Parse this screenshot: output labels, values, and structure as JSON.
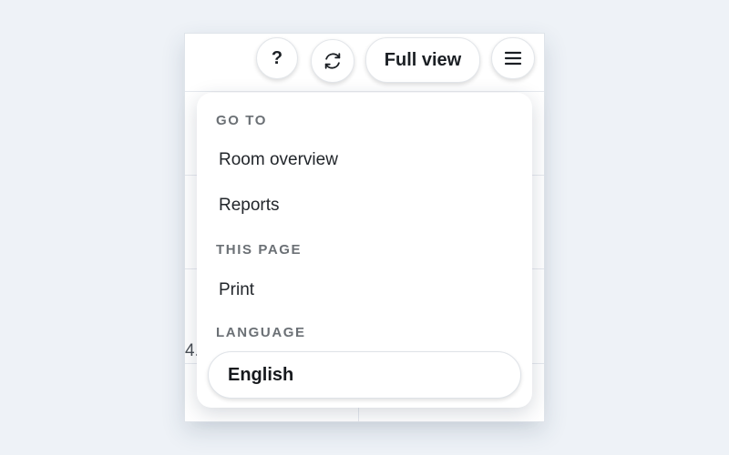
{
  "toolbar": {
    "help_label": "?",
    "refresh_icon": "refresh-icon",
    "fullview_label": "Full view",
    "menu_icon": "hamburger-menu-icon"
  },
  "background": {
    "partial_text": "4."
  },
  "menu": {
    "sections": [
      {
        "title": "GO TO",
        "items": [
          "Room overview",
          "Reports"
        ]
      },
      {
        "title": "THIS PAGE",
        "items": [
          "Print"
        ]
      },
      {
        "title": "LANGUAGE",
        "selected": "English"
      }
    ]
  }
}
